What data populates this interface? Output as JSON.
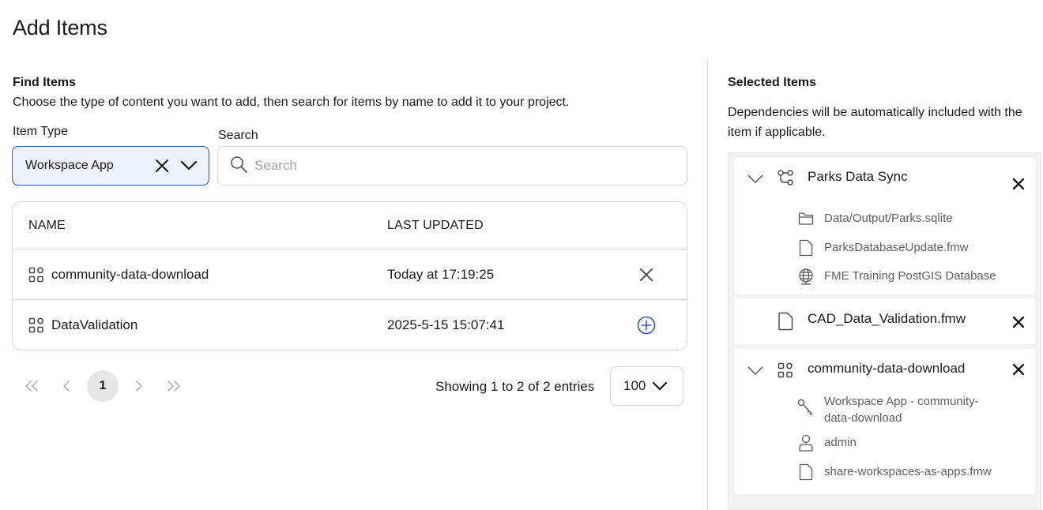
{
  "page": {
    "title": "Add Items"
  },
  "find": {
    "title": "Find Items",
    "description": "Choose the type of content you want to add, then search for items by name to add it to your project.",
    "item_type_label": "Item Type",
    "item_type_value": "Workspace App",
    "search_label": "Search",
    "search_placeholder": "Search",
    "search_value": ""
  },
  "table": {
    "headers": {
      "name": "NAME",
      "last_updated": "LAST UPDATED"
    },
    "rows": [
      {
        "icon": "app-grid-icon",
        "name": "community-data-download",
        "updated": "Today at 17:19:25",
        "action": "remove"
      },
      {
        "icon": "app-grid-icon",
        "name": "DataValidation",
        "updated": "2025-5-15 15:07:41",
        "action": "add"
      }
    ]
  },
  "pagination": {
    "current_page": "1",
    "showing": "Showing 1 to 2 of 2 entries",
    "per_page": "100"
  },
  "selected": {
    "title": "Selected Items",
    "description": "Dependencies will be automatically included with the item if applicable.",
    "items": [
      {
        "icon": "automation-icon",
        "name": "Parks Data Sync",
        "expanded": true,
        "deps": [
          {
            "icon": "folder-icon",
            "label": "Data/Output/Parks.sqlite"
          },
          {
            "icon": "file-icon",
            "label": "ParksDatabaseUpdate.fmw"
          },
          {
            "icon": "globe-icon",
            "label": "FME Training PostGIS Database"
          }
        ]
      },
      {
        "icon": "file-icon",
        "name": "CAD_Data_Validation.fmw",
        "expanded": false,
        "deps": []
      },
      {
        "icon": "app-grid-icon",
        "name": "community-data-download",
        "expanded": true,
        "deps": [
          {
            "icon": "key-icon",
            "label": "Workspace App - community-data-download"
          },
          {
            "icon": "user-icon",
            "label": "admin"
          },
          {
            "icon": "file-icon",
            "label": "share-workspaces-as-apps.fmw"
          }
        ]
      }
    ]
  },
  "colors": {
    "accent": "#2a56c6",
    "select_bg": "#eef2fb",
    "border": "#d6d6d6",
    "panel_bg": "#f2f2f2"
  }
}
